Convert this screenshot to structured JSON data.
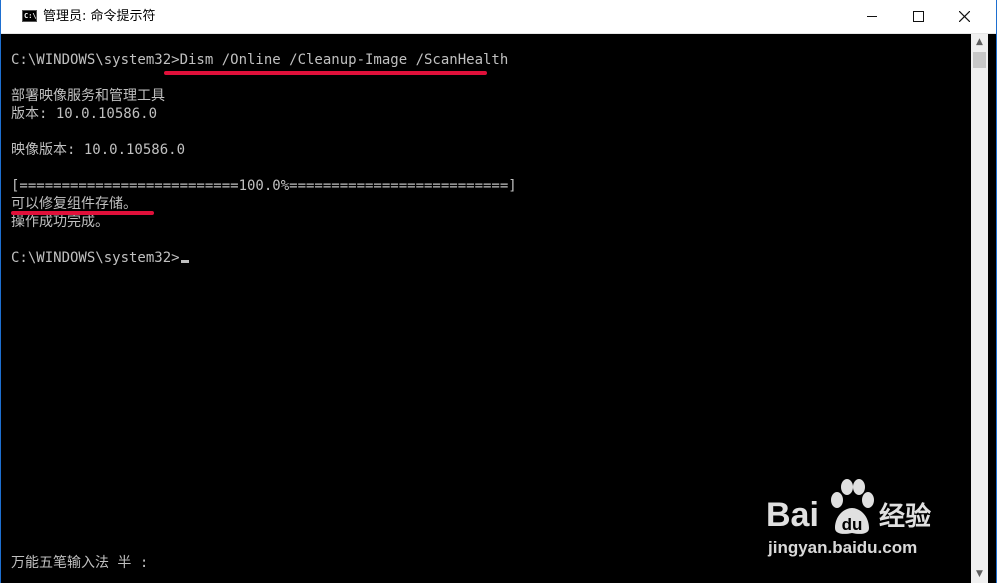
{
  "window": {
    "title": "管理员: 命令提示符",
    "icon": "cmd-icon",
    "controls": [
      "minimize-icon",
      "maximize-icon",
      "close-icon"
    ]
  },
  "console": {
    "lines": [
      "C:\\WINDOWS\\system32>Dism /Online /Cleanup-Image /ScanHealth",
      "",
      "部署映像服务和管理工具",
      "版本: 10.0.10586.0",
      "",
      "映像版本: 10.0.10586.0",
      "",
      "[==========================100.0%==========================]",
      "可以修复组件存储。",
      "操作成功完成。",
      "",
      "C:\\WINDOWS\\system32>"
    ],
    "ime_status": "万能五笔输入法 半 :"
  },
  "colors": {
    "console_bg": "#000000",
    "console_text": "#c0c0c0",
    "annotation": "#e0103a",
    "border": "#1e6fd0"
  },
  "watermark": {
    "brand": "Bai",
    "suffix": "经验",
    "url": "jingyan.baidu.com"
  }
}
